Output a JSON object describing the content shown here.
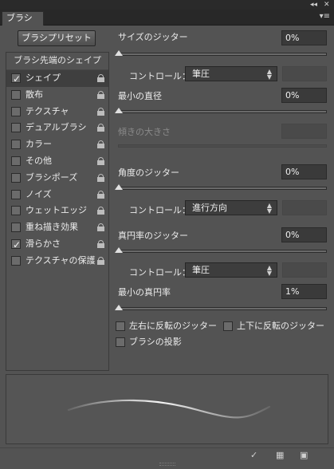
{
  "panel": {
    "tab_title": "ブラシ"
  },
  "preset_button": "ブラシプリセット",
  "list": {
    "header": "ブラシ先端のシェイプ",
    "items": [
      {
        "label": "シェイプ",
        "checked": true,
        "selected": true
      },
      {
        "label": "散布",
        "checked": false
      },
      {
        "label": "テクスチャ",
        "checked": false
      },
      {
        "label": "デュアルブラシ",
        "checked": false
      },
      {
        "label": "カラー",
        "checked": false
      },
      {
        "label": "その他",
        "checked": false
      },
      {
        "label": "ブラシポーズ",
        "checked": false
      },
      {
        "label": "ノイズ",
        "checked": false
      },
      {
        "label": "ウェットエッジ",
        "checked": false
      },
      {
        "label": "重ね描き効果",
        "checked": false
      },
      {
        "label": "滑らかさ",
        "checked": true
      },
      {
        "label": "テクスチャの保護",
        "checked": false
      }
    ]
  },
  "settings": {
    "size_jitter": {
      "label": "サイズのジッター",
      "value": "0%"
    },
    "size_control": {
      "label": "コントロール：",
      "value": "筆圧"
    },
    "min_diameter": {
      "label": "最小の直径",
      "value": "0%"
    },
    "tilt_scale": {
      "label": "傾きの大きさ"
    },
    "angle_jitter": {
      "label": "角度のジッター",
      "value": "0%"
    },
    "angle_control": {
      "label": "コントロール：",
      "value": "進行方向"
    },
    "roundness_jitter": {
      "label": "真円率のジッター",
      "value": "0%"
    },
    "roundness_control": {
      "label": "コントロール：",
      "value": "筆圧"
    },
    "min_roundness": {
      "label": "最小の真円率",
      "value": "1%"
    },
    "flip_x": {
      "label": "左右に反転のジッター",
      "checked": false
    },
    "flip_y": {
      "label": "上下に反転のジッター",
      "checked": false
    },
    "brush_projection": {
      "label": "ブラシの投影",
      "checked": false
    }
  }
}
